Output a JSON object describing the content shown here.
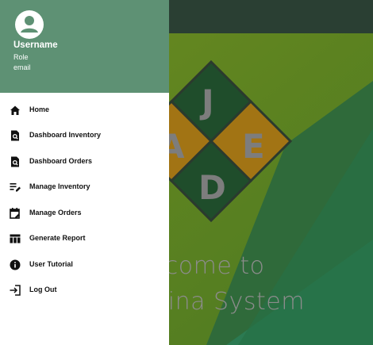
{
  "drawer": {
    "user": {
      "name": "Username",
      "role": "Role",
      "email": "email"
    },
    "items": [
      {
        "label": "Home",
        "icon": "home-icon"
      },
      {
        "label": "Dashboard Inventory",
        "icon": "page-search-icon"
      },
      {
        "label": "Dashboard Orders",
        "icon": "page-search-icon"
      },
      {
        "label": "Manage Inventory",
        "icon": "list-edit-icon"
      },
      {
        "label": "Manage Orders",
        "icon": "calendar-edit-icon"
      },
      {
        "label": "Generate Report",
        "icon": "table-icon"
      },
      {
        "label": "User Tutorial",
        "icon": "info-icon"
      },
      {
        "label": "Log Out",
        "icon": "logout-icon"
      }
    ]
  },
  "background": {
    "logo_letters": [
      "J",
      "A",
      "E",
      "D"
    ],
    "welcome_line1": "elcome to",
    "welcome_line2": "erina System"
  },
  "colors": {
    "drawer_header": "#5e9174",
    "topbar": "#2a3f33",
    "logo_green": "#2e6b3c",
    "logo_gold": "#b8861a"
  }
}
